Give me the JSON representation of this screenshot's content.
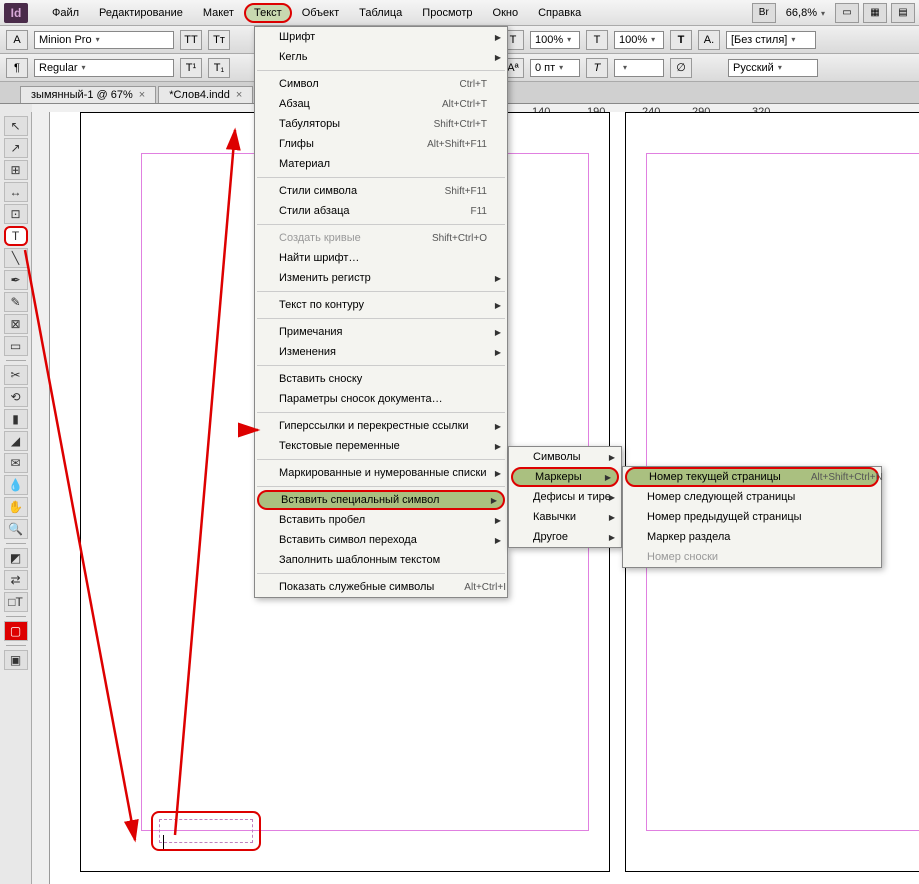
{
  "menubar": {
    "items": [
      "Файл",
      "Редактирование",
      "Макет",
      "Текст",
      "Объект",
      "Таблица",
      "Просмотр",
      "Окно",
      "Справка"
    ],
    "zoom": "66,8%"
  },
  "control1": {
    "font": "Minion Pro",
    "style": "Regular",
    "scale1": "100%",
    "scale2": "100%",
    "tracking": "0 пт",
    "charstyle": "[Без стиля]",
    "lang": "Русский"
  },
  "tabs": [
    {
      "label": "зымянный-1 @ 67%"
    },
    {
      "label": "*Слов4.indd"
    }
  ],
  "ruler_marks": [
    "140",
    "190",
    "240",
    "290",
    "320"
  ],
  "menu_text": {
    "groups": [
      [
        {
          "label": "Шрифт",
          "arrow": true
        },
        {
          "label": "Кегль",
          "arrow": true
        }
      ],
      [
        {
          "label": "Символ",
          "sc": "Ctrl+T"
        },
        {
          "label": "Абзац",
          "sc": "Alt+Ctrl+T"
        },
        {
          "label": "Табуляторы",
          "sc": "Shift+Ctrl+T"
        },
        {
          "label": "Глифы",
          "sc": "Alt+Shift+F11"
        },
        {
          "label": "Материал"
        }
      ],
      [
        {
          "label": "Стили символа",
          "sc": "Shift+F11"
        },
        {
          "label": "Стили абзаца",
          "sc": "F11"
        }
      ],
      [
        {
          "label": "Создать кривые",
          "sc": "Shift+Ctrl+O",
          "disabled": true
        },
        {
          "label": "Найти шрифт…"
        },
        {
          "label": "Изменить регистр",
          "arrow": true
        }
      ],
      [
        {
          "label": "Текст по контуру",
          "arrow": true
        }
      ],
      [
        {
          "label": "Примечания",
          "arrow": true
        },
        {
          "label": "Изменения",
          "arrow": true
        }
      ],
      [
        {
          "label": "Вставить сноску"
        },
        {
          "label": "Параметры сносок документа…"
        }
      ],
      [
        {
          "label": "Гиперссылки и перекрестные ссылки",
          "arrow": true
        },
        {
          "label": "Текстовые переменные",
          "arrow": true
        }
      ],
      [
        {
          "label": "Маркированные и нумерованные списки",
          "arrow": true
        }
      ],
      [
        {
          "label": "Вставить специальный символ",
          "arrow": true,
          "hl": true
        },
        {
          "label": "Вставить пробел",
          "arrow": true
        },
        {
          "label": "Вставить символ перехода",
          "arrow": true
        },
        {
          "label": "Заполнить шаблонным текстом"
        }
      ],
      [
        {
          "label": "Показать служебные символы",
          "sc": "Alt+Ctrl+I"
        }
      ]
    ]
  },
  "submenu1": [
    {
      "label": "Символы",
      "arrow": true
    },
    {
      "label": "Маркеры",
      "arrow": true,
      "hl": true
    },
    {
      "label": "Дефисы и тире",
      "arrow": true
    },
    {
      "label": "Кавычки",
      "arrow": true
    },
    {
      "label": "Другое",
      "arrow": true
    }
  ],
  "submenu2": [
    {
      "label": "Номер текущей страницы",
      "sc": "Alt+Shift+Ctrl+N",
      "hl": true
    },
    {
      "label": "Номер следующей страницы"
    },
    {
      "label": "Номер предыдущей страницы"
    },
    {
      "label": "Маркер раздела"
    },
    {
      "label": "Номер сноски",
      "disabled": true
    }
  ],
  "tools": [
    "sel",
    "dir",
    "page",
    "gap",
    "content",
    "type",
    "line",
    "pen",
    "pencil",
    "rect",
    "rectf",
    "scis",
    "trans",
    "grad",
    "gdrop",
    "note",
    "eyed",
    "hand",
    "zoom",
    "",
    "fill",
    "swp",
    "",
    "fmt",
    "scr",
    "",
    "view"
  ]
}
